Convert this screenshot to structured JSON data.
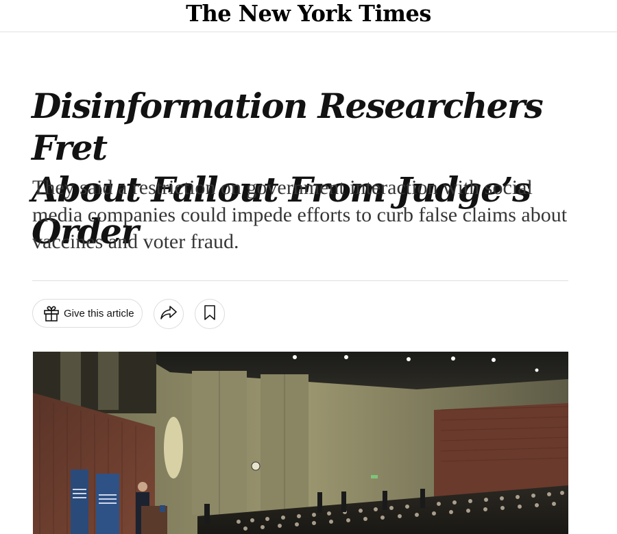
{
  "masthead": {
    "logo_text": "The New York Times"
  },
  "article": {
    "headline_line1": "Disinformation Researchers Fret",
    "headline_line2": "About Fallout From Judge’s Order",
    "summary": "They said a restriction on government interaction with social media companies could impede efforts to curb false claims about vaccines and voter fraud."
  },
  "share_tools": {
    "give_article_label": "Give this article",
    "give_icon": "gift-icon",
    "share_icon": "share-arrow-icon",
    "save_icon": "bookmark-icon"
  },
  "colors": {
    "text": "#121212",
    "summary_text": "#363636",
    "border": "#dcdcdc",
    "divider": "#dfdfdf"
  }
}
